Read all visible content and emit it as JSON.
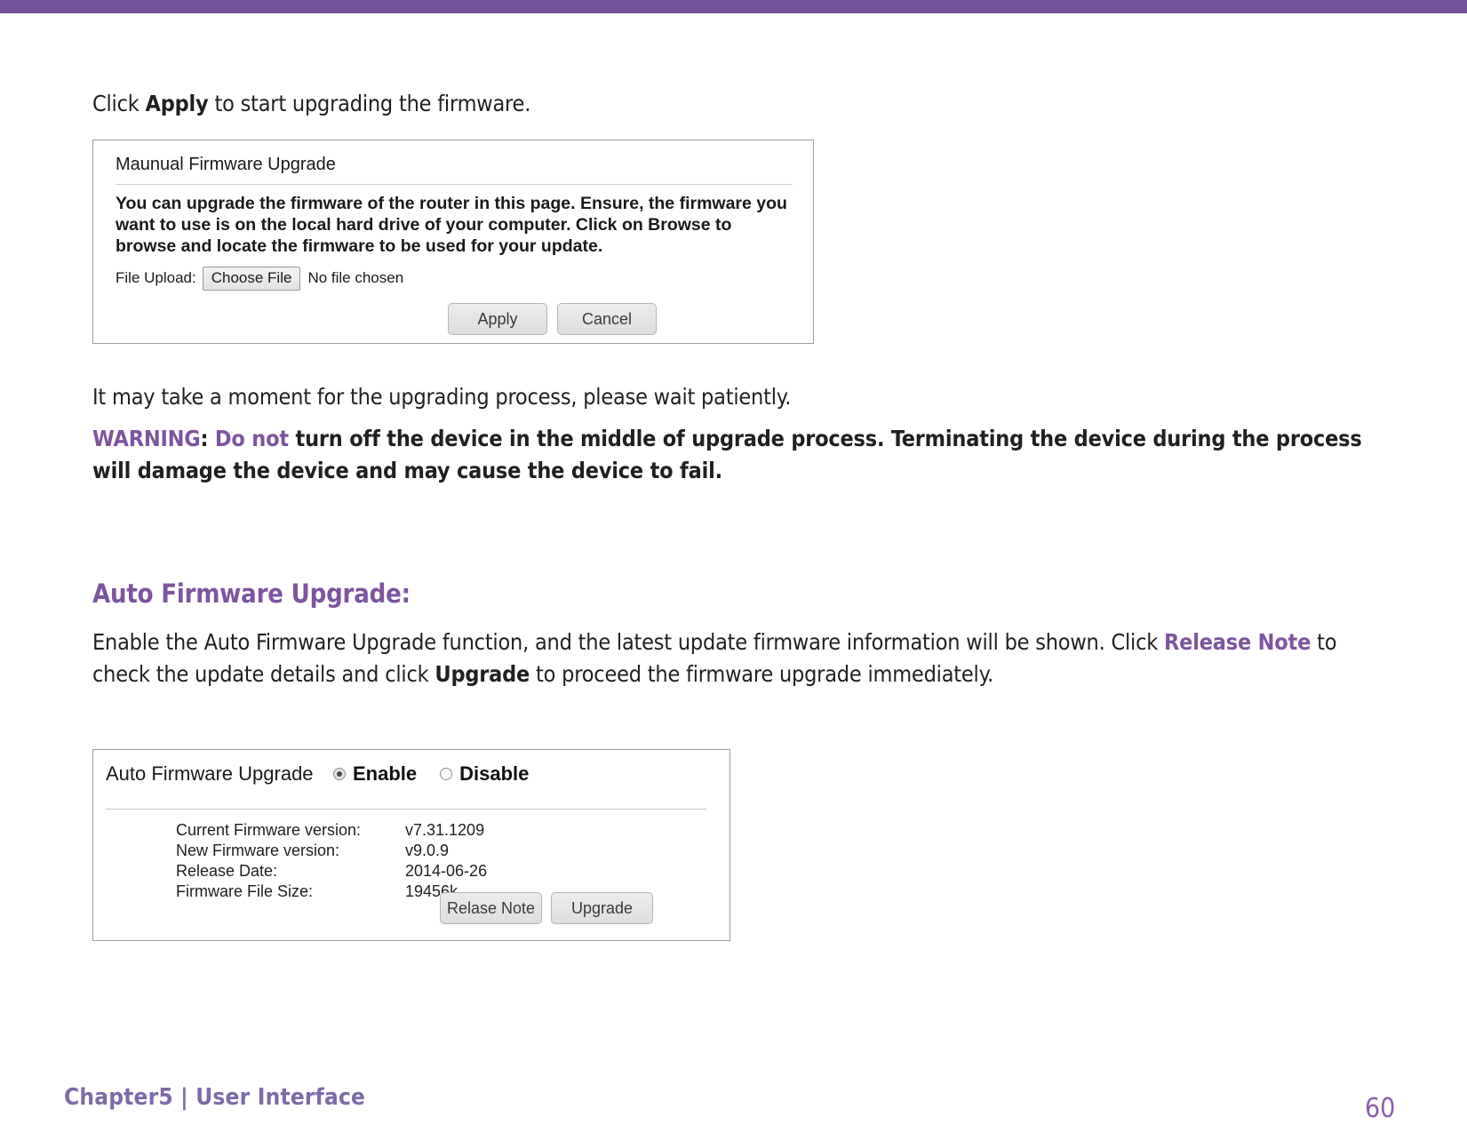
{
  "theme": {
    "accent_purple": "#74529b",
    "heading_purple": "#7d559f",
    "footer_purple": "#7d6aa8",
    "page_number_purple": "#8a5fb0",
    "body_text": "#231f20"
  },
  "intro": {
    "before": "Click ",
    "bold": "Apply",
    "after": " to start upgrading the firmware."
  },
  "manual_panel": {
    "title": "Maunual Firmware Upgrade",
    "description": "You can upgrade the firmware of the router in this page. Ensure, the firmware you want to use is on the local hard drive of your computer. Click on Browse to browse and locate the firmware to be used for your update.",
    "file_upload_label": "File Upload:",
    "choose_file_button": "Choose File",
    "no_file_text": "No file chosen",
    "apply_button": "Apply",
    "cancel_button": "Cancel"
  },
  "wait_note": "It may take a moment for the upgrading process, please wait patiently.",
  "warning": {
    "label": "WARNING",
    "colon": ": ",
    "emphasis": "Do not",
    "rest": " turn off the device in the middle of upgrade process. Terminating the device during the process will damage the device and may cause the device to fail."
  },
  "auto_section": {
    "heading": "Auto Firmware Upgrade:",
    "desc_part1": "Enable the Auto Firmware Upgrade function, and the latest update firmware information will be shown. Click ",
    "desc_link": "Release Note",
    "desc_part2": " to check the update details and click ",
    "desc_bold": "Upgrade",
    "desc_part3": " to proceed the firmware upgrade immediately."
  },
  "auto_panel": {
    "title": "Auto Firmware Upgrade",
    "radio_enable": "Enable",
    "radio_disable": "Disable",
    "selected_radio": "Enable",
    "rows": [
      {
        "key": "Current Firmware version:",
        "value": "v7.31.1209"
      },
      {
        "key": "New Firmware version:",
        "value": "v9.0.9"
      },
      {
        "key": "Release Date:",
        "value": "2014-06-26"
      },
      {
        "key": "Firmware File Size:",
        "value": "19456k"
      }
    ],
    "release_note_button": "Relase Note",
    "upgrade_button": "Upgrade"
  },
  "footer": {
    "left": "Chapter5  |  User Interface",
    "page_number": "60"
  }
}
